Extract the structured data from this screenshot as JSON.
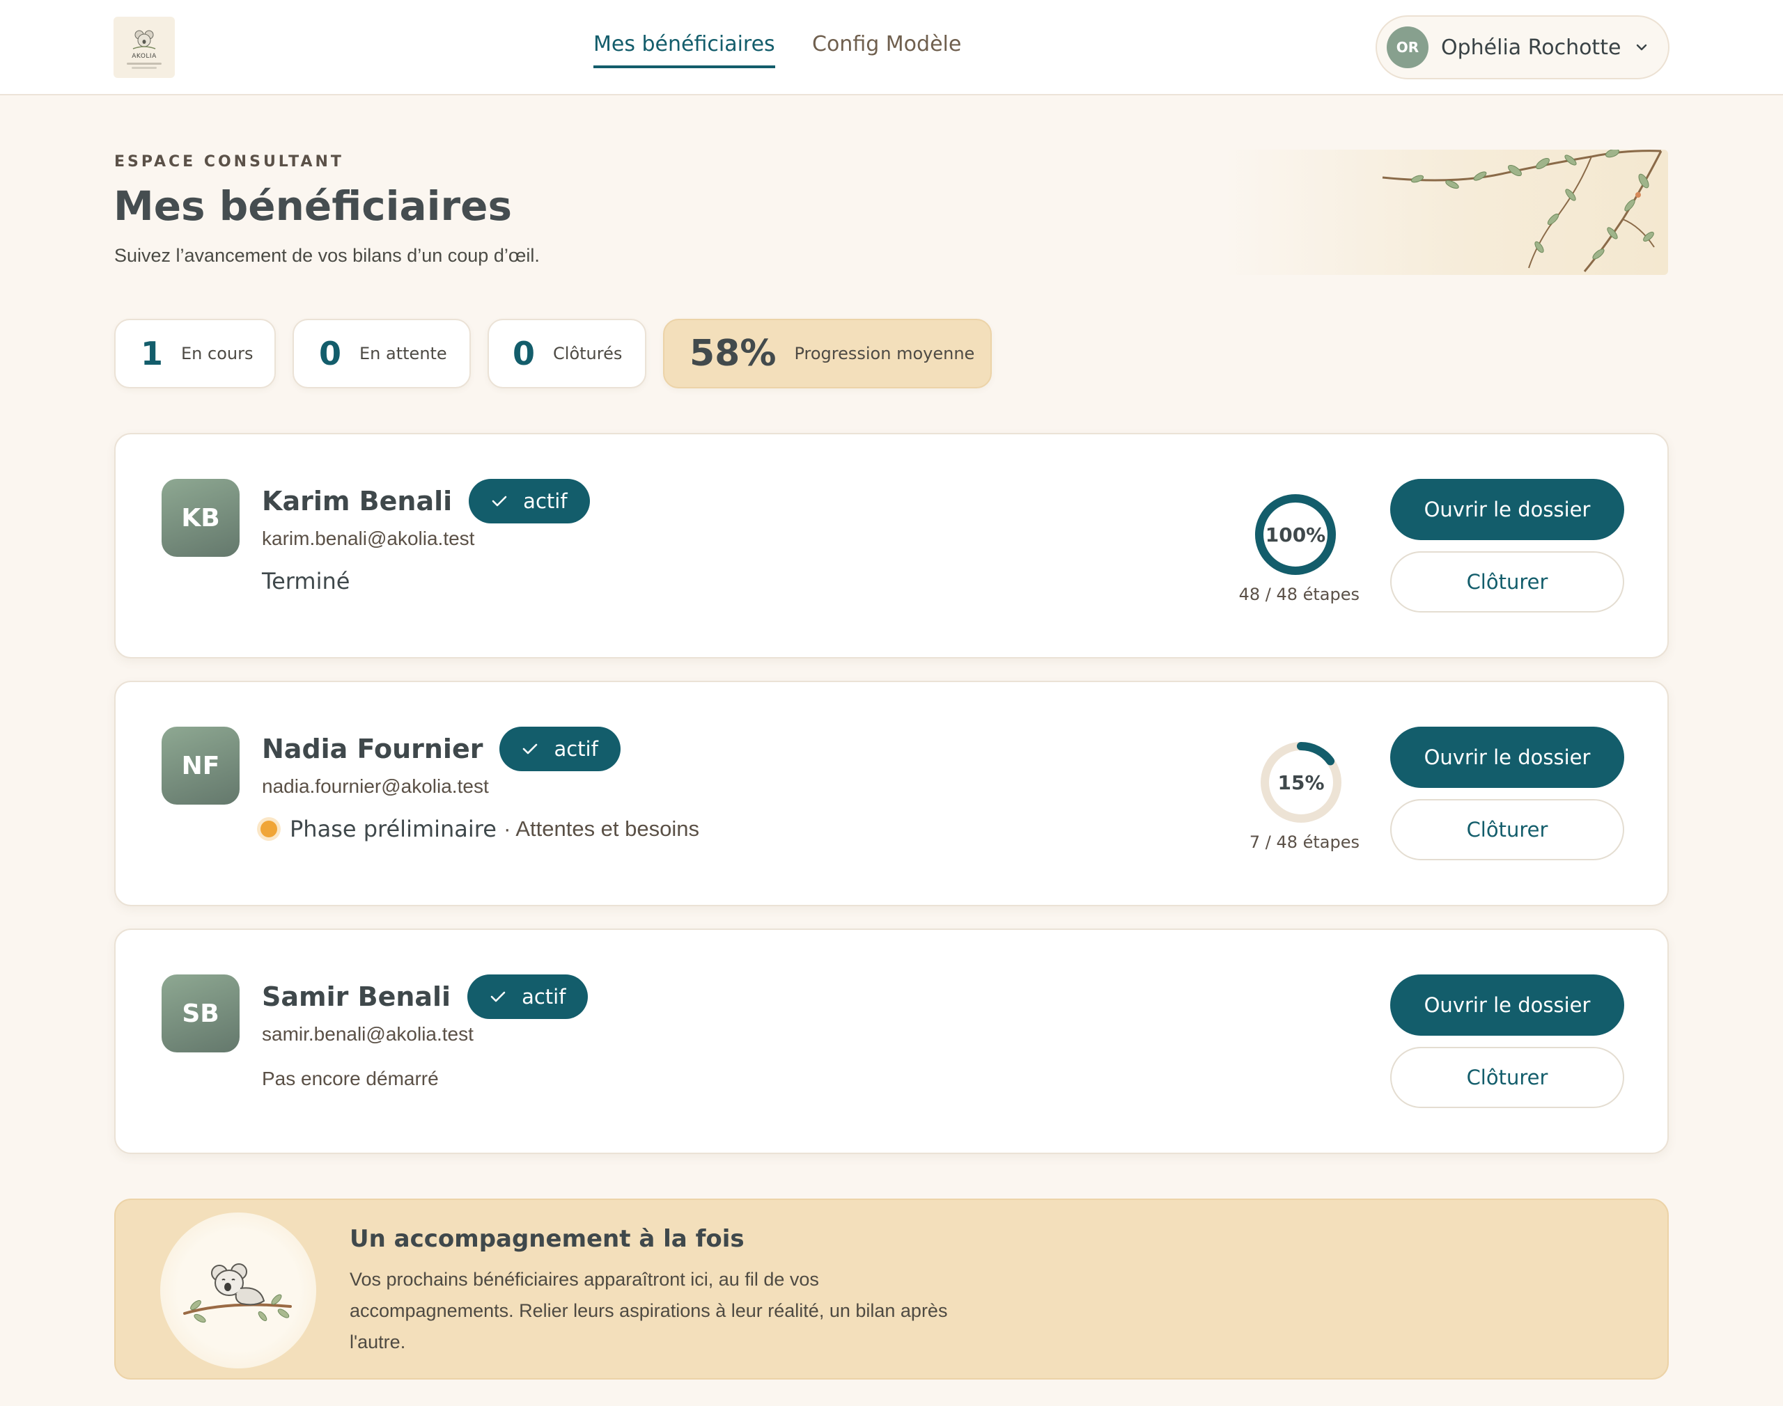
{
  "header": {
    "logo_text": "AKOLIA",
    "tabs": [
      {
        "label": "Mes bénéficiaires",
        "active": true
      },
      {
        "label": "Config Modèle",
        "active": false
      }
    ],
    "user": {
      "initials": "OR",
      "name": "Ophélia Rochotte"
    }
  },
  "hero": {
    "eyebrow": "ESPACE CONSULTANT",
    "title": "Mes bénéficiaires",
    "subtitle": "Suivez l’avancement de vos bilans d’un coup d’œil."
  },
  "stats": [
    {
      "value": "1",
      "label": "En cours"
    },
    {
      "value": "0",
      "label": "En attente"
    },
    {
      "value": "0",
      "label": "Clôturés"
    },
    {
      "value": "58%",
      "label": "Progression moyenne"
    }
  ],
  "beneficiaries": [
    {
      "initials": "KB",
      "name": "Karim Benali",
      "badge": "actif",
      "email": "karim.benali@akolia.test",
      "status": "Terminé",
      "progress_label": "100%",
      "progress": 1.0,
      "steps": "48 / 48 étapes",
      "open_label": "Ouvrir le dossier",
      "close_label": "Clôturer"
    },
    {
      "initials": "NF",
      "name": "Nadia Fournier",
      "badge": "actif",
      "email": "nadia.fournier@akolia.test",
      "phase": "Phase préliminaire",
      "phase_detail": "· Attentes et besoins",
      "progress_label": "15%",
      "progress": 0.15,
      "steps": "7 / 48 étapes",
      "open_label": "Ouvrir le dossier",
      "close_label": "Clôturer"
    },
    {
      "initials": "SB",
      "name": "Samir Benali",
      "badge": "actif",
      "email": "samir.benali@akolia.test",
      "status": "Pas encore démarré",
      "open_label": "Ouvrir le dossier",
      "close_label": "Clôturer"
    }
  ],
  "banner": {
    "title": "Un accompagnement à la fois",
    "text": "Vos prochains bénéficiaires apparaîtront ici, au fil de vos accompagnements. Relier leurs aspirations à leur réalité, un bilan après l'autre."
  },
  "colors": {
    "accent": "#135d6b",
    "background": "#fbf6f0",
    "highlight": "#f3dfbb",
    "ring_track": "#ede3d5",
    "phase_dot": "#f0a537"
  },
  "icons": {
    "badge": "check-icon",
    "user_menu": "chevron-down-icon",
    "banner": "koala-icon",
    "hero": "branch-illustration"
  }
}
